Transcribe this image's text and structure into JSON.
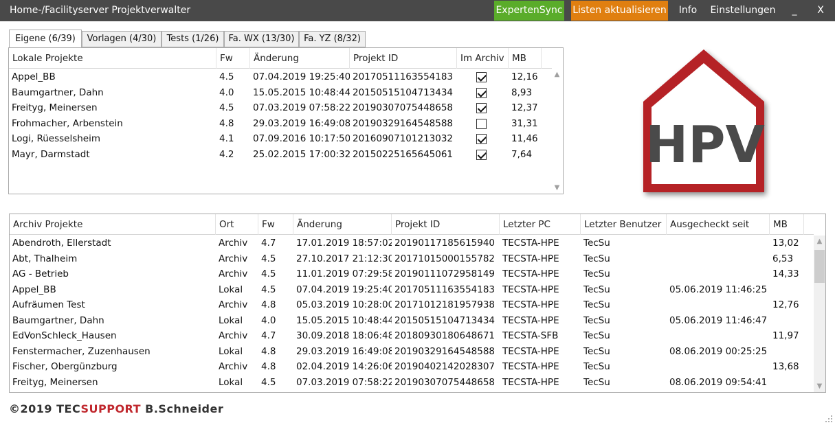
{
  "titlebar": {
    "title": "Home-/Facilityserver Projektverwalter",
    "expertensync": "ExpertenSync",
    "listen": "Listen aktualisieren",
    "info": "Info",
    "settings": "Einstellungen",
    "minimize": "_",
    "close": "X",
    "colors": {
      "bar": "#494949",
      "expertensync": "#5aac2a",
      "listen": "#e07f10"
    }
  },
  "tabs": [
    {
      "label": "Eigene (6/39)"
    },
    {
      "label": "Vorlagen (4/30)"
    },
    {
      "label": "Tests (1/26)"
    },
    {
      "label": "Fa. WX (13/30)"
    },
    {
      "label": "Fa. YZ (8/32)"
    }
  ],
  "local": {
    "headers": [
      "Lokale Projekte",
      "Fw",
      "Änderung",
      "Projekt ID",
      "Im Archiv",
      "MB"
    ],
    "rows": [
      {
        "name": "Appel_BB",
        "fw": "4.5",
        "date": "07.04.2019 19:25:40",
        "id": "20170511163554183",
        "archived": true,
        "mb": "12,16"
      },
      {
        "name": "Baumgartner, Dahn",
        "fw": "4.0",
        "date": "15.05.2015 10:48:44",
        "id": "20150515104713434",
        "archived": true,
        "mb": "8,93"
      },
      {
        "name": "Freityg, Meinersen",
        "fw": "4.5",
        "date": "07.03.2019 07:58:22",
        "id": "20190307075448658",
        "archived": true,
        "mb": "12,37"
      },
      {
        "name": "Frohmacher, Arbenstein",
        "fw": "4.8",
        "date": "29.03.2019 16:49:08",
        "id": "20190329164548588",
        "archived": false,
        "mb": "31,31"
      },
      {
        "name": "Logi, Rüesselsheim",
        "fw": "4.1",
        "date": "07.09.2016 10:17:50",
        "id": "20160907101213032",
        "archived": true,
        "mb": "11,46"
      },
      {
        "name": "Mayr, Darmstadt",
        "fw": "4.2",
        "date": "25.02.2015 17:00:32",
        "id": "20150225165645061",
        "archived": true,
        "mb": "7,64"
      }
    ]
  },
  "archive": {
    "headers": [
      "Archiv Projekte",
      "Ort",
      "Fw",
      "Änderung",
      "Projekt ID",
      "Letzter PC",
      "Letzter Benutzer",
      "Ausgecheckt seit",
      "MB"
    ],
    "rows": [
      {
        "name": "Abendroth, Ellerstadt",
        "ort": "Archiv",
        "fw": "4.7",
        "date": "17.01.2019 18:57:02",
        "id": "20190117185615940",
        "pc": "TECSTA-HPE",
        "user": "TecSu",
        "since": "",
        "mb": "13,02"
      },
      {
        "name": "Abt, Thalheim",
        "ort": "Archiv",
        "fw": "4.5",
        "date": "27.10.2017 21:12:30",
        "id": "20171015000155782",
        "pc": "TECSTA-HPE",
        "user": "TecSu",
        "since": "",
        "mb": "6,53"
      },
      {
        "name": "AG - Betrieb",
        "ort": "Archiv",
        "fw": "4.5",
        "date": "11.01.2019 07:29:58",
        "id": "20190111072958149",
        "pc": "TECSTA-HPE",
        "user": "TecSu",
        "since": "",
        "mb": "14,33"
      },
      {
        "name": "Appel_BB",
        "ort": "Lokal",
        "fw": "4.5",
        "date": "07.04.2019 19:25:40",
        "id": "20170511163554183",
        "pc": "TECSTA-HPE",
        "user": "TecSu",
        "since": "05.06.2019 11:46:25",
        "mb": ""
      },
      {
        "name": "Aufräumen Test",
        "ort": "Archiv",
        "fw": "4.8",
        "date": "05.03.2019 10:28:00",
        "id": "20171012181957938",
        "pc": "TECSTA-HPE",
        "user": "TecSu",
        "since": "",
        "mb": "12,76"
      },
      {
        "name": "Baumgartner, Dahn",
        "ort": "Lokal",
        "fw": "4.0",
        "date": "15.05.2015 10:48:44",
        "id": "20150515104713434",
        "pc": "TECSTA-HPE",
        "user": "TecSu",
        "since": "05.06.2019 11:46:47",
        "mb": ""
      },
      {
        "name": "EdVonSchleck_Hausen",
        "ort": "Archiv",
        "fw": "4.7",
        "date": "30.09.2018 18:06:48",
        "id": "20180930180648671",
        "pc": "TECSTA-SFB",
        "user": "TecSu",
        "since": "",
        "mb": "11,97"
      },
      {
        "name": "Fenstermacher, Zuzenhausen",
        "ort": "Lokal",
        "fw": "4.8",
        "date": "29.03.2019 16:49:08",
        "id": "20190329164548588",
        "pc": "TECSTA-HPE",
        "user": "TecSu",
        "since": "08.06.2019 00:25:25",
        "mb": ""
      },
      {
        "name": "Fischer, Obergünzburg",
        "ort": "Archiv",
        "fw": "4.8",
        "date": "02.04.2019 14:26:06",
        "id": "20190402142028307",
        "pc": "TECSTA-HPE",
        "user": "TecSu",
        "since": "",
        "mb": "13,68"
      },
      {
        "name": "Freityg, Meinersen",
        "ort": "Lokal",
        "fw": "4.5",
        "date": "07.03.2019 07:58:22",
        "id": "20190307075448658",
        "pc": "TECSTA-HPE",
        "user": "TecSu",
        "since": "08.06.2019 09:54:41",
        "mb": ""
      }
    ]
  },
  "logo": {
    "text": "HPV",
    "colors": {
      "red": "#b52025",
      "gray": "#4a4a4a"
    }
  },
  "footer": {
    "prefix": "©2019 TEC",
    "highlight": "SUPPORT",
    "suffix": " B.Schneider",
    "colors": {
      "text": "#333333",
      "highlight": "#c0272d"
    }
  }
}
